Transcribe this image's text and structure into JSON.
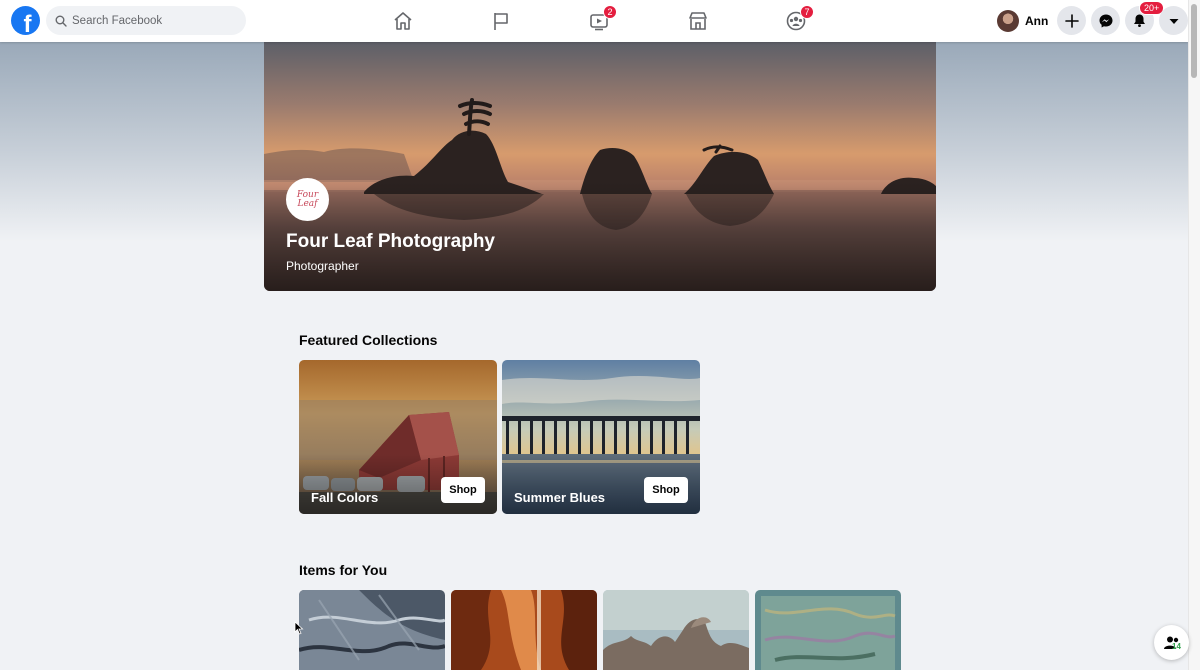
{
  "topbar": {
    "search_placeholder": "Search Facebook",
    "nav": [
      {
        "icon": "home-icon",
        "badge": ""
      },
      {
        "icon": "flag-icon",
        "badge": ""
      },
      {
        "icon": "watch-icon",
        "badge": "2"
      },
      {
        "icon": "marketplace-icon",
        "badge": ""
      },
      {
        "icon": "groups-icon",
        "badge": "7"
      }
    ],
    "user_name": "Ann",
    "notifications_badge": "20+"
  },
  "page": {
    "name": "Four Leaf Photography",
    "category": "Photographer",
    "logo_text": "Four Leaf"
  },
  "featured": {
    "title": "Featured Collections",
    "collections": [
      {
        "label": "Fall Colors",
        "button": "Shop"
      },
      {
        "label": "Summer Blues",
        "button": "Shop"
      }
    ]
  },
  "items": {
    "title": "Items for You"
  },
  "contacts": {
    "count": "14"
  },
  "colors": {
    "brand": "#1877f2",
    "badge": "#e41e3f",
    "background": "#f0f2f5"
  }
}
